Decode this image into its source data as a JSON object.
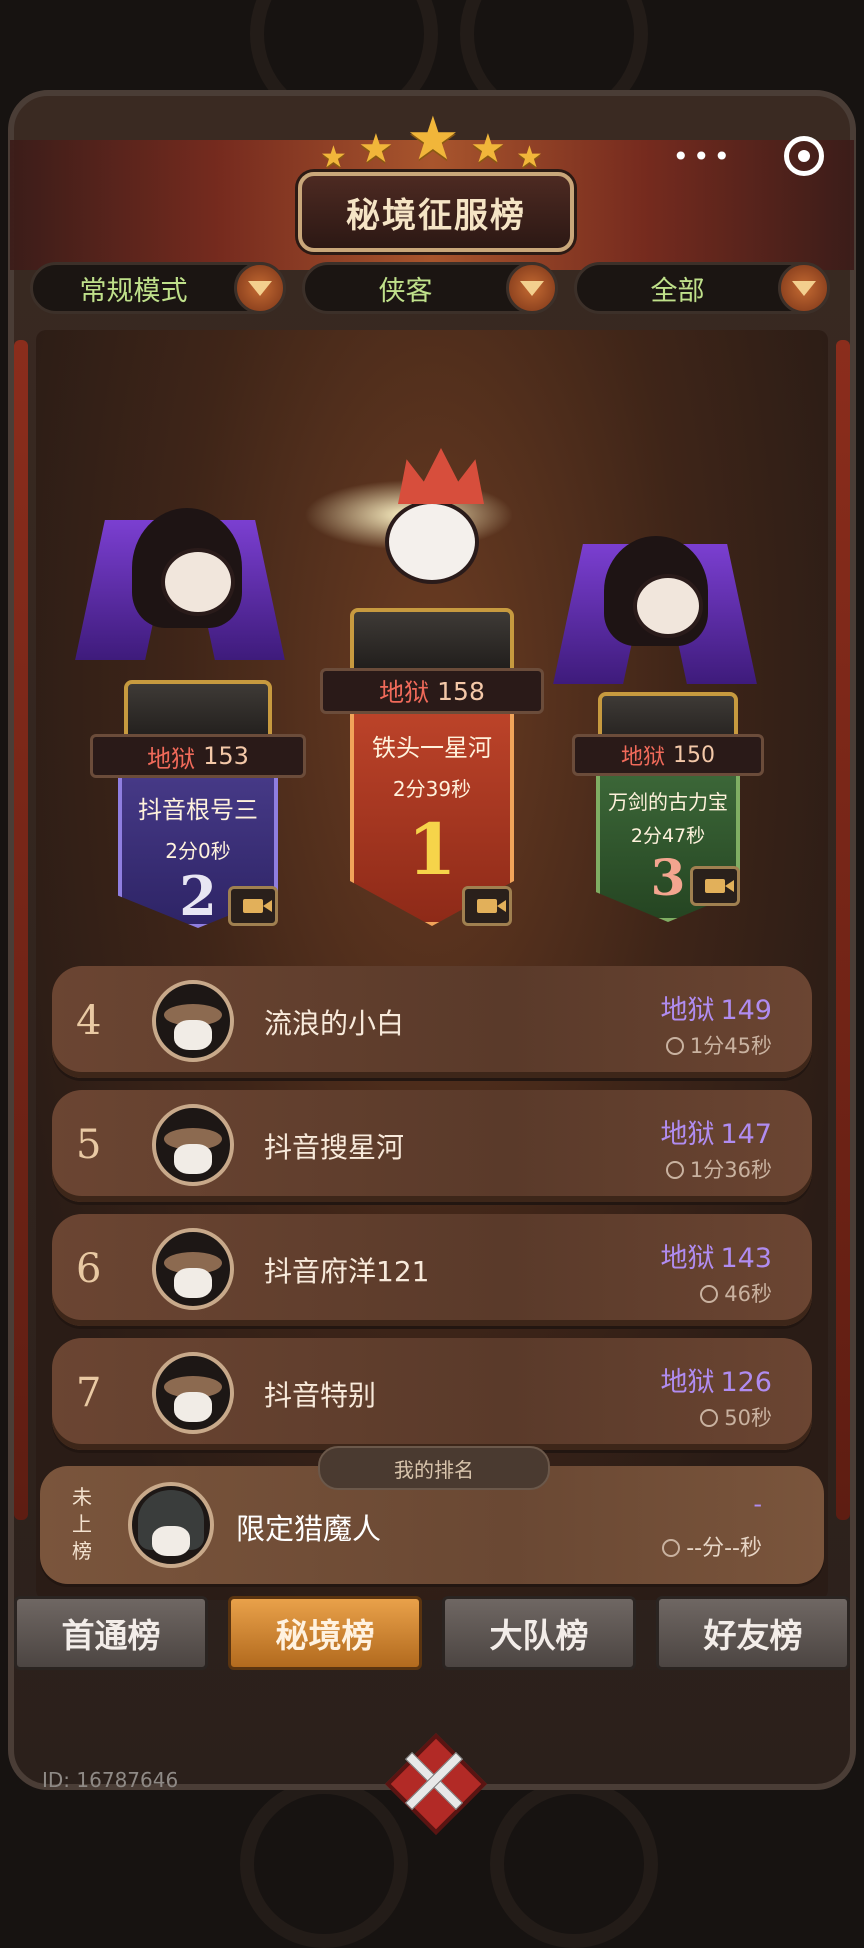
{
  "header": {
    "title": "秘境征服榜",
    "menu_icon": "more-dots-icon",
    "target_icon": "target-icon"
  },
  "filters": [
    {
      "label": "常规模式"
    },
    {
      "label": "侠客"
    },
    {
      "label": "全部"
    }
  ],
  "podium": [
    {
      "rank": "1",
      "level_label": "地狱",
      "level": "158",
      "name": "铁头一星河",
      "time": "2分39秒"
    },
    {
      "rank": "2",
      "level_label": "地狱",
      "level": "153",
      "name": "抖音根号三",
      "time": "2分0秒"
    },
    {
      "rank": "3",
      "level_label": "地狱",
      "level": "150",
      "name": "万剑的古力宝",
      "time": "2分47秒"
    }
  ],
  "list": [
    {
      "rank": "4",
      "name": "流浪的小白",
      "level_label": "地狱",
      "level": "149",
      "time": "1分45秒"
    },
    {
      "rank": "5",
      "name": "抖音搜星河",
      "level_label": "地狱",
      "level": "147",
      "time": "1分36秒"
    },
    {
      "rank": "6",
      "name": "抖音府洋121",
      "level_label": "地狱",
      "level": "143",
      "time": "46秒"
    },
    {
      "rank": "7",
      "name": "抖音特别",
      "level_label": "地狱",
      "level": "126",
      "time": "50秒"
    }
  ],
  "my_rank": {
    "tab_label": "我的排名",
    "status": "未上榜",
    "name": "限定猎魔人",
    "level": "-",
    "time": "--分--秒"
  },
  "tabs": [
    {
      "label": "首通榜",
      "active": false
    },
    {
      "label": "秘境榜",
      "active": true
    },
    {
      "label": "大队榜",
      "active": false
    },
    {
      "label": "好友榜",
      "active": false
    }
  ],
  "footer": {
    "id_text": "ID: 16787646"
  },
  "colors": {
    "accent": "#e9a14a",
    "level_purple": "#b08cf0",
    "hell_red": "#f06a5a",
    "filter_green": "#bfe08a"
  }
}
